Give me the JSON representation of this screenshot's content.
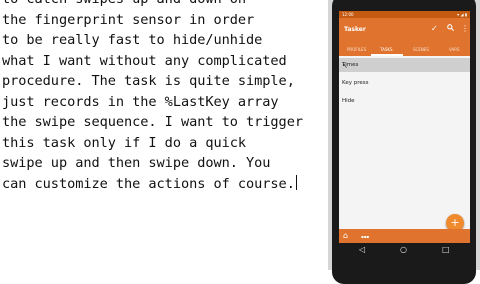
{
  "editor": {
    "lines": [
      "to catch swipes up and down on",
      "the fingerprint sensor in order",
      "to be really fast to hide/unhide",
      "what I want without any complicated",
      "procedure. The task is quite simple,",
      "just records in the %LastKey array",
      "the swipe sequence. I want to trigger",
      "this task only if I do a quick",
      "swipe up and then swipe down. You",
      "can customize the actions of course."
    ]
  },
  "phone": {
    "status": {
      "time": "12:00",
      "icons": "▾ ◢ ▮"
    },
    "app": {
      "title": "Tasker",
      "icons": {
        "check": "check-icon",
        "search": "search-icon",
        "menu": "more-vert-icon"
      }
    },
    "tabs": [
      {
        "label": "PROFILES",
        "active": false
      },
      {
        "label": "TASKS",
        "active": true
      },
      {
        "label": "SCENES",
        "active": false
      },
      {
        "label": "VARS",
        "active": false
      }
    ],
    "tasks": [
      {
        "label": "Times",
        "selected": true
      },
      {
        "label": "Key press",
        "selected": false
      },
      {
        "label": "Hide",
        "selected": false
      }
    ],
    "fab": "+",
    "bottom": {
      "label": "▪▪▪"
    },
    "nav": {
      "back": "◁",
      "home": "○",
      "recents": "□"
    },
    "colors": {
      "primary": "#e0732e",
      "status": "#c55a11",
      "accent": "#f08a2e"
    }
  }
}
